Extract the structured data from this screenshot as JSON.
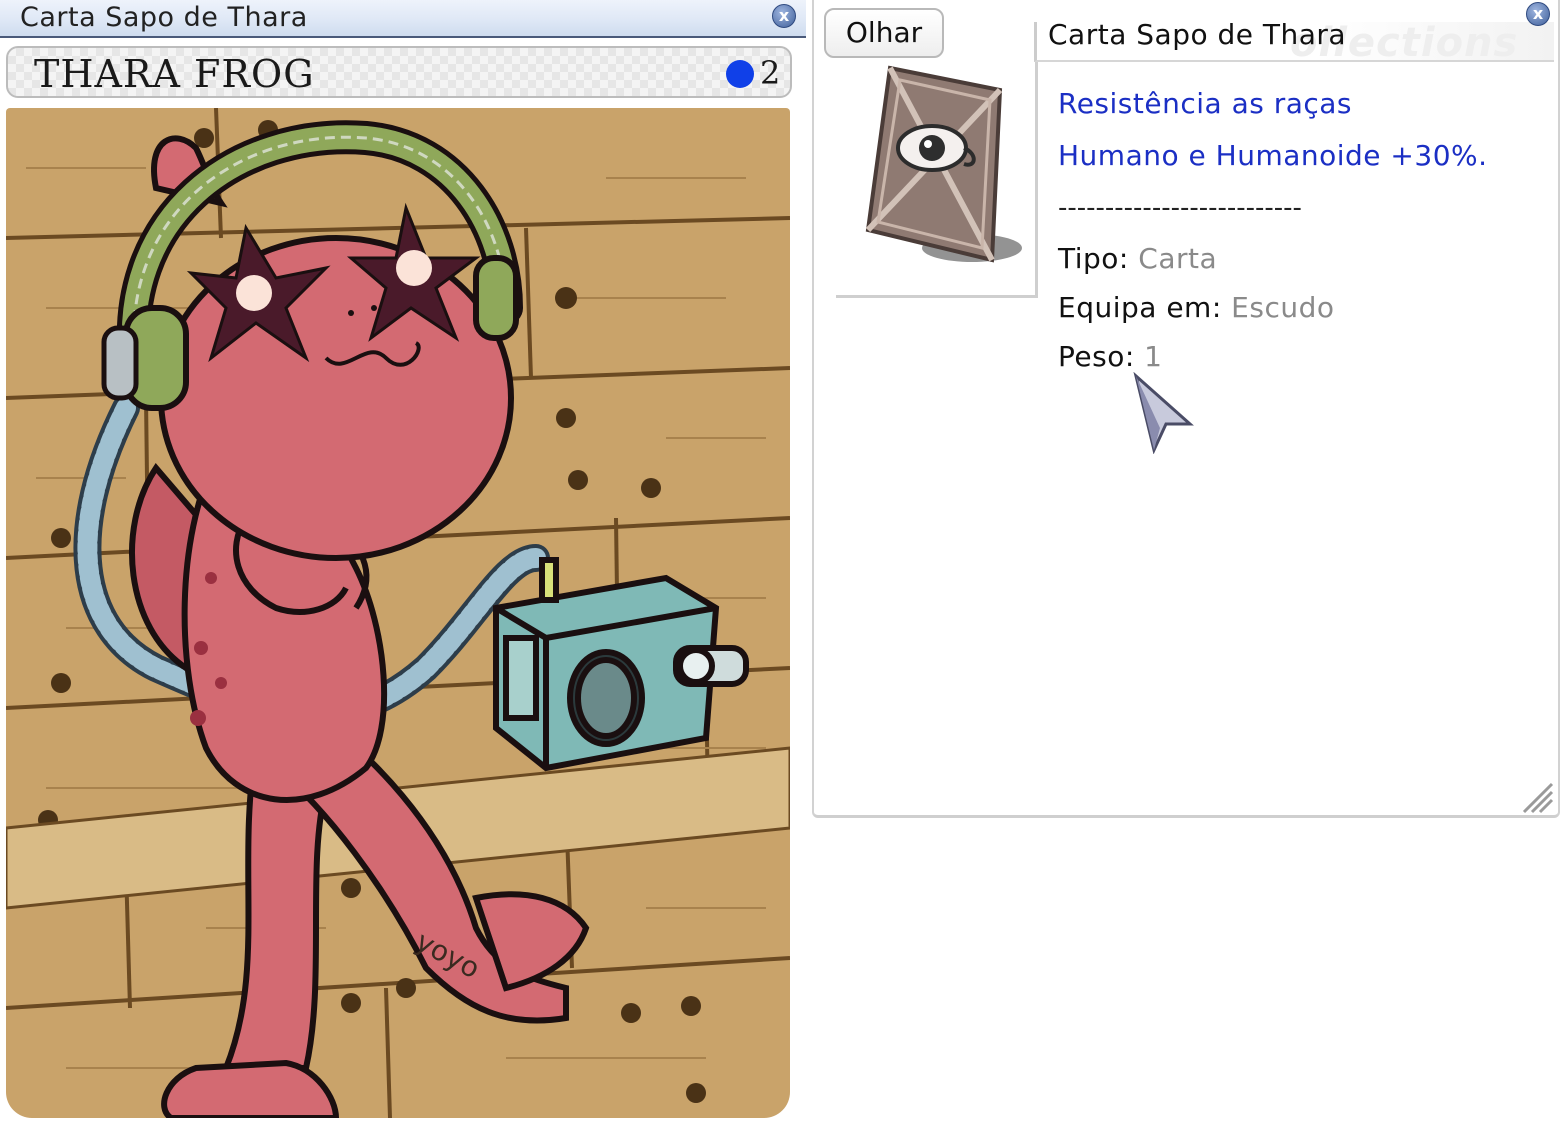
{
  "card_window": {
    "title": "Carta Sapo de Thara",
    "close_label": "x",
    "card_name": "THARA FROG",
    "slot_count": "2",
    "artist_signature": "yoyo",
    "colors": {
      "slot_dot": "#1040e8",
      "frog": "#d36a72",
      "wood": "#c9a36a"
    }
  },
  "info_window": {
    "look_button": "Olhar",
    "title": "Carta Sapo de Thara",
    "watermark": "ollections",
    "close_label": "x",
    "description": [
      "Resistência as raças",
      "Humano e Humanoide +30%."
    ],
    "separator": "--------------------------",
    "properties": [
      {
        "label": "Tipo:",
        "value": "Carta"
      },
      {
        "label": "Equipa em:",
        "value": "Escudo"
      },
      {
        "label": "Peso:",
        "value": "1"
      }
    ],
    "colors": {
      "description": "#1b2fc4",
      "value": "#8a8a8a"
    }
  },
  "icons": {
    "card_icon": "eye-card-icon",
    "cursor": "mouse-pointer-icon",
    "close": "close-icon",
    "grip": "resize-grip-icon"
  }
}
